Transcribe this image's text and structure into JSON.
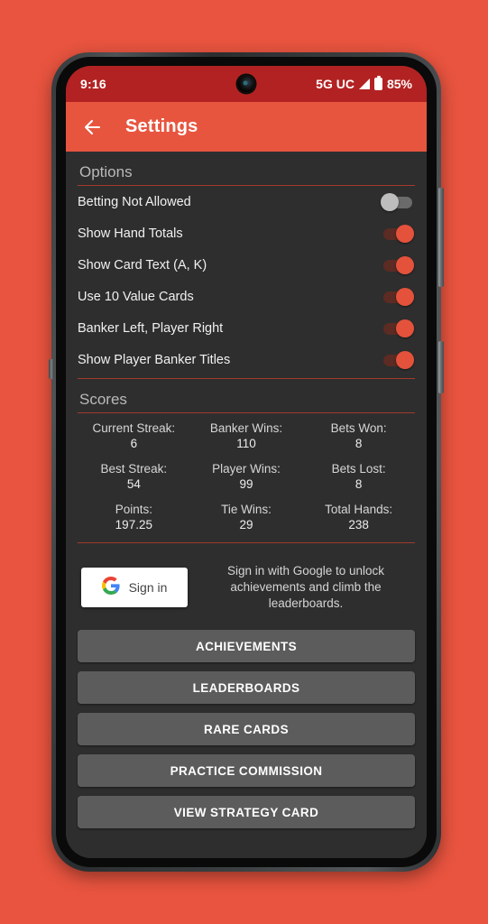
{
  "status_bar": {
    "clock": "9:16",
    "network": "5G UC",
    "battery_percent": "85%",
    "icons": [
      "camera-cutout",
      "signal-icon",
      "battery-icon"
    ]
  },
  "app_bar": {
    "back_icon": "back-arrow-icon",
    "title": "Settings"
  },
  "options": {
    "header": "Options",
    "rows": [
      {
        "label": "Betting Not Allowed",
        "state": "off"
      },
      {
        "label": "Show Hand Totals",
        "state": "on"
      },
      {
        "label": "Show Card Text (A, K)",
        "state": "on"
      },
      {
        "label": "Use 10 Value Cards",
        "state": "on"
      },
      {
        "label": "Banker Left, Player Right",
        "state": "on"
      },
      {
        "label": "Show Player Banker Titles",
        "state": "on"
      }
    ]
  },
  "scores": {
    "header": "Scores",
    "cells": [
      {
        "label": "Current Streak:",
        "value": "6"
      },
      {
        "label": "Banker Wins:",
        "value": "110"
      },
      {
        "label": "Bets Won:",
        "value": "8"
      },
      {
        "label": "Best Streak:",
        "value": "54"
      },
      {
        "label": "Player Wins:",
        "value": "99"
      },
      {
        "label": "Bets Lost:",
        "value": "8"
      },
      {
        "label": "Points:",
        "value": "197.25"
      },
      {
        "label": "Tie Wins:",
        "value": "29"
      },
      {
        "label": "Total Hands:",
        "value": "238"
      }
    ]
  },
  "signin": {
    "button_label": "Sign in",
    "google_icon": "google-g-icon",
    "hint": "Sign in with Google to unlock achievements and climb the leaderboards."
  },
  "actions": [
    {
      "label": "ACHIEVEMENTS"
    },
    {
      "label": "LEADERBOARDS"
    },
    {
      "label": "RARE CARDS"
    },
    {
      "label": "PRACTICE COMMISSION"
    },
    {
      "label": "VIEW STRATEGY CARD"
    }
  ],
  "nav_bar": {
    "back": "nav-back-icon",
    "home": "nav-home-icon",
    "recents": "nav-recents-icon"
  },
  "colors": {
    "page_background": "#e8543f",
    "status_bar": "#b22222",
    "app_bar": "#e8553f",
    "content_background": "#2e2e2e",
    "accent_red": "#e4523c",
    "divider_red": "#a33a2c",
    "button_grey": "#5c5c5c"
  }
}
